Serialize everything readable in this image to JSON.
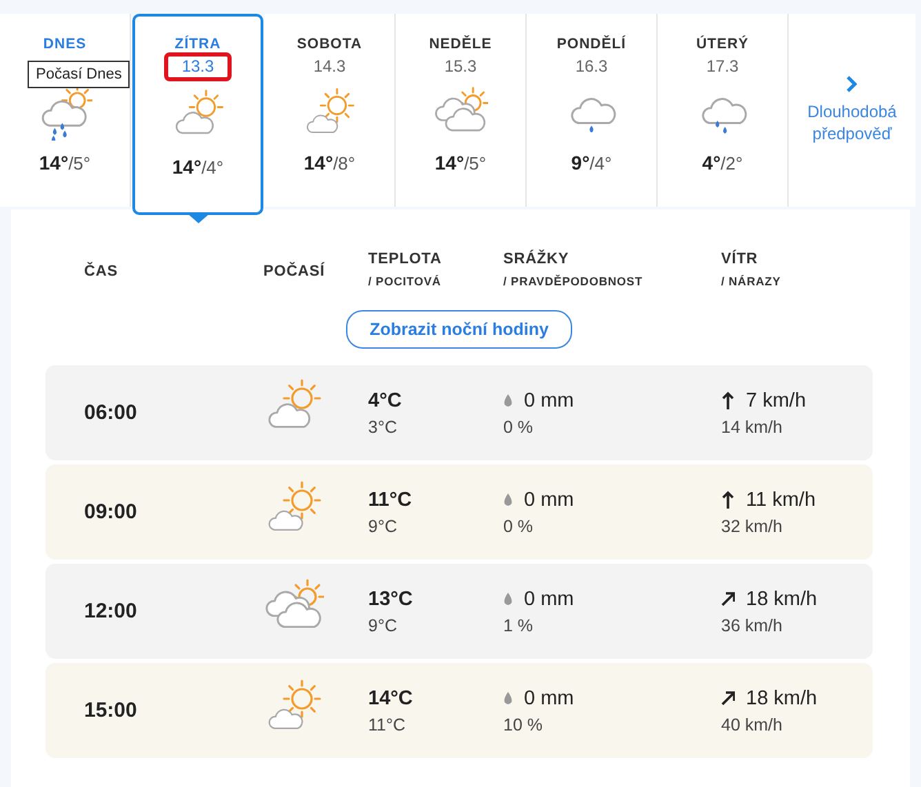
{
  "days": [
    {
      "label": "DNES",
      "kind": "sun-cloud-rain",
      "high": "14°",
      "low": "/5°",
      "selected": false,
      "tooltip": "Počasí Dnes"
    },
    {
      "label": "ZÍTRA",
      "date": "13.3",
      "kind": "sun-cloud",
      "high": "14°",
      "low": "/4°",
      "selected": true,
      "highlighted": true
    },
    {
      "label": "SOBOTA",
      "date": "14.3",
      "kind": "sun-cloud-low",
      "high": "14°",
      "low": "/8°",
      "selected": false
    },
    {
      "label": "NEDĚLE",
      "date": "15.3",
      "kind": "clouds-sun",
      "high": "14°",
      "low": "/5°",
      "selected": false
    },
    {
      "label": "PONDĚLÍ",
      "date": "16.3",
      "kind": "cloud-drop",
      "high": "9°",
      "low": "/4°",
      "selected": false
    },
    {
      "label": "ÚTERÝ",
      "date": "17.3",
      "kind": "cloud-drops",
      "high": "4°",
      "low": "/2°",
      "selected": false
    }
  ],
  "long_term": {
    "label": "Dlouhodobá předpověď"
  },
  "columns": [
    {
      "title": "ČAS"
    },
    {
      "title": "POČASÍ"
    },
    {
      "title": "TEPLOTA",
      "sub": "/ POCITOVÁ"
    },
    {
      "title": "SRÁŽKY",
      "sub": "/ PRAVDĚPODOBNOST"
    },
    {
      "title": "VÍTR",
      "sub": "/ NÁRAZY"
    }
  ],
  "night_button": "Zobrazit noční hodiny",
  "hours": [
    {
      "time": "06:00",
      "kind": "sun-cloud",
      "temp": "4°C",
      "feels": "3°C",
      "precip": "0 mm",
      "chance": "0 %",
      "wind": {
        "kind": "north",
        "speed": "7 km/h",
        "gusts": "14 km/h"
      },
      "color": "#f3f3f3"
    },
    {
      "time": "09:00",
      "kind": "sun-cloud-low",
      "temp": "11°C",
      "feels": "9°C",
      "precip": "0 mm",
      "chance": "0 %",
      "wind": {
        "kind": "north",
        "speed": "11 km/h",
        "gusts": "32 km/h"
      },
      "color": "#f9f6ee"
    },
    {
      "time": "12:00",
      "kind": "clouds-sun",
      "temp": "13°C",
      "feels": "9°C",
      "precip": "0 mm",
      "chance": "1 %",
      "wind": {
        "kind": "northeast",
        "speed": "18 km/h",
        "gusts": "36 km/h"
      },
      "color": "#f3f3f3"
    },
    {
      "time": "15:00",
      "kind": "sun-cloud-low",
      "temp": "14°C",
      "feels": "11°C",
      "precip": "0 mm",
      "chance": "10 %",
      "wind": {
        "kind": "northeast",
        "speed": "18 km/h",
        "gusts": "40 km/h"
      },
      "color": "#f9f6ee"
    }
  ]
}
